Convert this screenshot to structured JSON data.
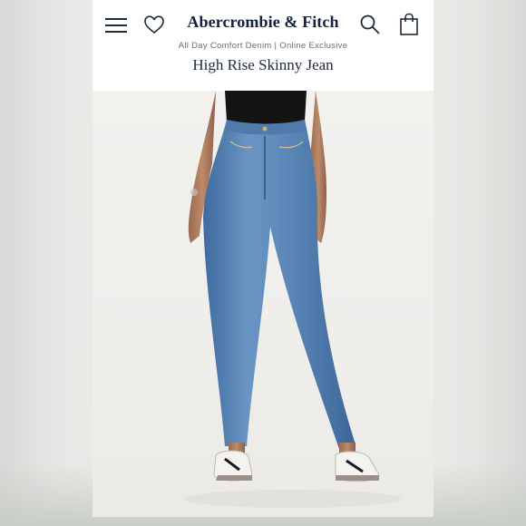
{
  "header": {
    "brand": "Abercrombie & Fitch",
    "collection": "All Day Comfort Denim | Online Exclusive",
    "product_title": "High Rise Skinny Jean"
  },
  "icons": {
    "menu": "hamburger-menu-icon",
    "wishlist": "heart-icon",
    "search": "search-icon",
    "bag": "shopping-bag-icon"
  },
  "colors": {
    "brand_navy": "#14213d",
    "denim": "#5a86b8",
    "top": "#141414"
  }
}
